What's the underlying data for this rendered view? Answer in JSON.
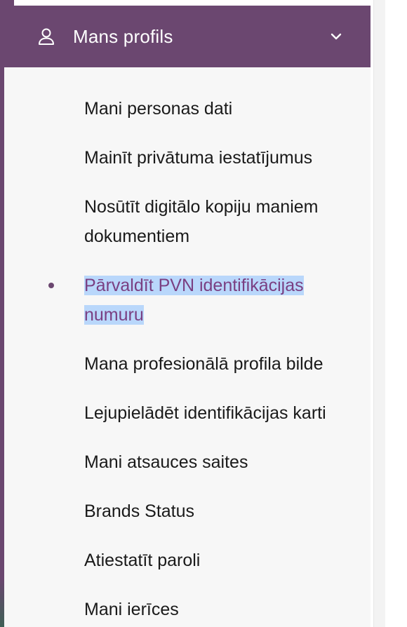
{
  "header": {
    "title": "Mans profils",
    "icon": "user-icon",
    "expand_icon": "chevron-down-icon"
  },
  "menu": {
    "items": [
      {
        "label": "Mani personas dati",
        "active": false
      },
      {
        "label": "Mainīt privātuma iestatījumus",
        "active": false
      },
      {
        "label": "Nosūtīt digitālo kopiju maniem dokumentiem",
        "active": false
      },
      {
        "label": "Pārvaldīt PVN identifikācijas numuru",
        "active": true
      },
      {
        "label": "Mana profesionālā profila bilde",
        "active": false
      },
      {
        "label": "Lejupielādēt identifikācijas karti",
        "active": false
      },
      {
        "label": "Mani atsauces saites",
        "active": false
      },
      {
        "label": "Brands Status",
        "active": false
      },
      {
        "label": "Atiestatīt paroli",
        "active": false
      },
      {
        "label": "Mani ierīces",
        "active": false
      }
    ]
  },
  "colors": {
    "header_bg": "#6b4770",
    "active_text": "#7a3f82",
    "active_highlight": "#b9d7fb",
    "panel_bg": "#f7f7f7"
  }
}
